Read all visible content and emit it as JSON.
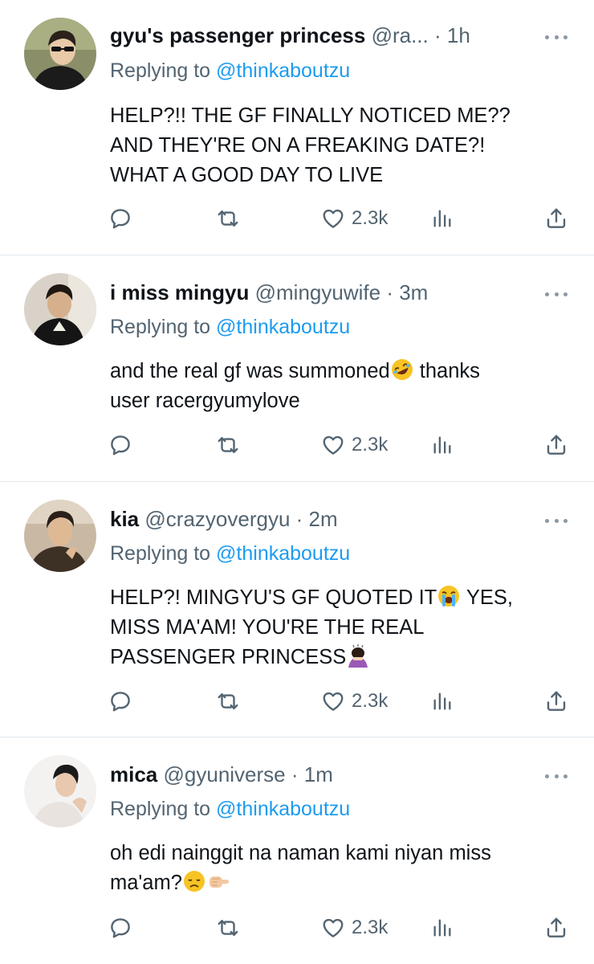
{
  "tweets": [
    {
      "name": "gyu's passenger princess",
      "handle": "@ra...",
      "dot": "·",
      "time": "1h",
      "reply_prefix": "Replying to",
      "reply_to": "@thinkaboutzu",
      "body_lines": [
        "HELP?!! THE GF FINALLY NOTICED ME??",
        "AND THEY'RE ON A FREAKING DATE?!",
        "WHAT A GOOD DAY TO LIVE"
      ],
      "likes": "2.3k"
    },
    {
      "name": "i miss mingyu",
      "handle": "@mingyuwife",
      "dot": "·",
      "time": "3m",
      "reply_prefix": "Replying to",
      "reply_to": "@thinkaboutzu",
      "body_line1a": "and the real gf was summoned",
      "body_line1b": " thanks",
      "body_line2": "user racergyumylove",
      "emoji": "rolling-on-floor-laughing-emoji",
      "likes": "2.3k"
    },
    {
      "name": "kia",
      "handle": "@crazyovergyu",
      "dot": "·",
      "time": "2m",
      "reply_prefix": "Replying to",
      "reply_to": "@thinkaboutzu",
      "body_line1a": "HELP?! MINGYU'S GF QUOTED IT",
      "body_line1b": " YES,",
      "body_line2": "MISS MA'AM! YOU'RE THE REAL",
      "body_line3": "PASSENGER PRINCESS",
      "emoji1": "loudly-crying-emoji",
      "emoji2": "person-bowing-emoji",
      "likes": "2.3k"
    },
    {
      "name": "mica",
      "handle": "@gyuniverse",
      "dot": "·",
      "time": "1m",
      "reply_prefix": "Replying to",
      "reply_to": "@thinkaboutzu",
      "body_line1": "oh edi nainggit na naman kami niyan miss",
      "body_line2": "ma'am?",
      "emoji1": "disappointed-face-emoji",
      "emoji2": "pointing-hand-emoji",
      "likes": "2.3k"
    }
  ],
  "icons": {
    "reply": "reply-icon",
    "retweet": "retweet-icon",
    "like": "heart-icon",
    "analytics": "analytics-icon",
    "share": "share-icon",
    "more": "more-icon"
  },
  "colors": {
    "link": "#1d9bf0",
    "secondary_text": "#536471",
    "divider": "#e1e8ed"
  }
}
